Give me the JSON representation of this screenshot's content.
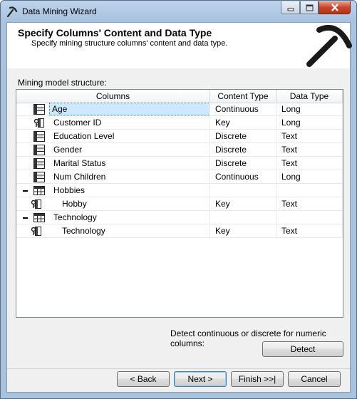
{
  "window": {
    "title": "Data Mining Wizard"
  },
  "header": {
    "title": "Specify Columns' Content and Data Type",
    "subtitle": "Specify mining structure columns' content and data type."
  },
  "structure_label": "Mining model structure:",
  "grid": {
    "columns": [
      "Columns",
      "Content Type",
      "Data Type"
    ],
    "rows": [
      {
        "name": "Age",
        "content": "Continuous",
        "dtype": "Long",
        "icon": "column-icon",
        "selected": true
      },
      {
        "name": "Customer ID",
        "content": "Key",
        "dtype": "Long",
        "icon": "key-icon"
      },
      {
        "name": "Education Level",
        "content": "Discrete",
        "dtype": "Text",
        "icon": "column-icon"
      },
      {
        "name": "Gender",
        "content": "Discrete",
        "dtype": "Text",
        "icon": "column-icon"
      },
      {
        "name": "Marital Status",
        "content": "Discrete",
        "dtype": "Text",
        "icon": "column-icon"
      },
      {
        "name": "Num Children",
        "content": "Continuous",
        "dtype": "Long",
        "icon": "column-icon"
      },
      {
        "name": "Hobbies",
        "content": "",
        "dtype": "",
        "icon": "table-icon",
        "expanded": true
      },
      {
        "name": "Hobby",
        "content": "Key",
        "dtype": "Text",
        "icon": "key-icon",
        "child": true
      },
      {
        "name": "Technology",
        "content": "",
        "dtype": "",
        "icon": "table-icon",
        "expanded": true
      },
      {
        "name": "Technology",
        "content": "Key",
        "dtype": "Text",
        "icon": "key-icon",
        "child": true
      }
    ]
  },
  "detect": {
    "label": "Detect continuous or discrete for numeric columns:",
    "button": "Detect"
  },
  "footer": {
    "back": "< Back",
    "next": "Next >",
    "finish": "Finish >>|",
    "cancel": "Cancel"
  }
}
